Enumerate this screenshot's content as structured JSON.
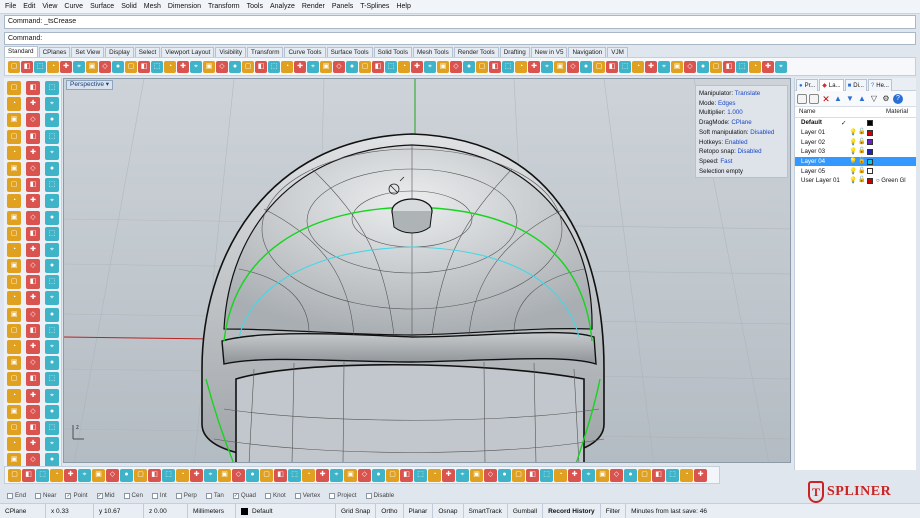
{
  "menu": [
    "File",
    "Edit",
    "View",
    "Curve",
    "Surface",
    "Solid",
    "Mesh",
    "Dimension",
    "Transform",
    "Tools",
    "Analyze",
    "Render",
    "Panels",
    "T-Splines",
    "Help"
  ],
  "command_history": "Command: _tsCrease",
  "command_prompt": "Command:",
  "tabs": [
    "Standard",
    "CPlanes",
    "Set View",
    "Display",
    "Select",
    "Viewport Layout",
    "Visibility",
    "Transform",
    "Curve Tools",
    "Surface Tools",
    "Solid Tools",
    "Mesh Tools",
    "Render Tools",
    "Drafting",
    "New in V5",
    "Navigation",
    "VJM"
  ],
  "viewport": {
    "title": "Perspective"
  },
  "osd": {
    "manipulator_label": "Manipulator:",
    "manipulator_value": "Translate",
    "mode_label": "Mode:",
    "mode_value": "Edges",
    "multiplier_label": "Multiplier:",
    "multiplier_value": "1.000",
    "dragmode_label": "DragMode:",
    "dragmode_value": "CPlane",
    "softmanip_label": "Soft manipulation:",
    "softmanip_value": "Disabled",
    "hotkeys_label": "Hotkeys:",
    "hotkeys_value": "Enabled",
    "retopo_label": "Retopo snap:",
    "retopo_value": "Disabled",
    "speed_label": "Speed:",
    "speed_value": "Fast",
    "selection": "Selection empty"
  },
  "panel": {
    "tabs": [
      "Pr...",
      "La...",
      "Di...",
      "He..."
    ],
    "col_name": "Name",
    "col_material": "Material",
    "layers": [
      {
        "name": "Default",
        "current": true,
        "color": "#000000",
        "material": ""
      },
      {
        "name": "Layer 01",
        "current": false,
        "color": "#cc0000",
        "material": ""
      },
      {
        "name": "Layer 02",
        "current": false,
        "color": "#6b20c8",
        "material": ""
      },
      {
        "name": "Layer 03",
        "current": false,
        "color": "#2222bb",
        "material": ""
      },
      {
        "name": "Layer 04",
        "current": false,
        "color": "#00c8e6",
        "material": "",
        "selected": true
      },
      {
        "name": "Layer 05",
        "current": false,
        "color": "#ffffff",
        "material": ""
      },
      {
        "name": "User Layer 01",
        "current": false,
        "color": "#cc0000",
        "material": "Green Gl"
      }
    ],
    "current_mark": "✓"
  },
  "osnap": [
    {
      "label": "End",
      "checked": false
    },
    {
      "label": "Near",
      "checked": false
    },
    {
      "label": "Point",
      "checked": true
    },
    {
      "label": "Mid",
      "checked": true
    },
    {
      "label": "Cen",
      "checked": false
    },
    {
      "label": "Int",
      "checked": false
    },
    {
      "label": "Perp",
      "checked": false
    },
    {
      "label": "Tan",
      "checked": false
    },
    {
      "label": "Quad",
      "checked": true
    },
    {
      "label": "Knot",
      "checked": false
    },
    {
      "label": "Vertex",
      "checked": false
    },
    {
      "label": "Project",
      "checked": false
    },
    {
      "label": "Disable",
      "checked": false
    }
  ],
  "status": {
    "cplane": "CPlane",
    "x": "x 0.33",
    "y": "y 10.67",
    "z": "z 0.00",
    "units": "Millimeters",
    "layer": "Default",
    "grid_snap": "Grid Snap",
    "ortho": "Ortho",
    "planar": "Planar",
    "osnap": "Osnap",
    "smarttrack": "SmartTrack",
    "gumball": "Gumball",
    "record_history": "Record History",
    "filter": "Filter",
    "minutes": "Minutes from last save: 46"
  },
  "logo": {
    "mark": "T",
    "text": "SPLINER"
  },
  "colors": {
    "accent": "#3399ff",
    "model_edge_green": "#17d41e",
    "model_edge_cyan": "#43d7e6"
  }
}
